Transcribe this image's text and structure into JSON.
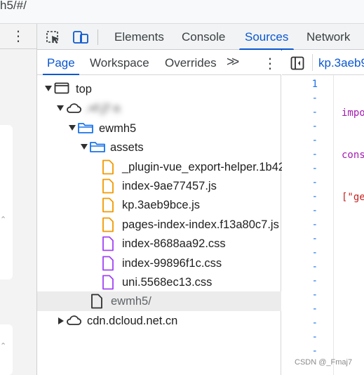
{
  "browser": {
    "url_fragment": "h5/#/"
  },
  "devtools": {
    "tabs": [
      {
        "label": "Elements",
        "active": false
      },
      {
        "label": "Console",
        "active": false
      },
      {
        "label": "Sources",
        "active": true
      },
      {
        "label": "Network",
        "active": false
      }
    ],
    "accent_color": "#0b57d0"
  },
  "navigator": {
    "tabs": [
      {
        "label": "Page",
        "active": true
      },
      {
        "label": "Workspace",
        "active": false
      },
      {
        "label": "Overrides",
        "active": false
      }
    ],
    "more_label": ">>",
    "tree": {
      "top": "top",
      "domain_redacted": "  .+f  j7  n",
      "folder_ewmh5": "ewmh5",
      "folder_assets": "assets",
      "files": [
        {
          "name": "_plugin-vue_export-helper.1b42",
          "type": "js"
        },
        {
          "name": "index-9ae77457.js",
          "type": "js"
        },
        {
          "name": "kp.3aeb9bce.js",
          "type": "js"
        },
        {
          "name": "pages-index-index.f13a80c7.js",
          "type": "js"
        },
        {
          "name": "index-8688aa92.css",
          "type": "css"
        },
        {
          "name": "index-99896f1c.css",
          "type": "css"
        },
        {
          "name": "uni.5568ec13.css",
          "type": "css"
        }
      ],
      "document": "ewmh5/",
      "cdn": "cdn.dcloud.net.cn"
    },
    "file_colors": {
      "js": "#f29900",
      "css": "#a142f4"
    }
  },
  "editor": {
    "open_file_tab": "kp.3aeb9",
    "line_numbers": [
      "1",
      "-",
      "-",
      "-",
      "-",
      "-",
      "-",
      "-",
      "-",
      "-",
      "-",
      "-",
      "-",
      "-",
      "-",
      "-",
      "-",
      "-",
      "-",
      "-"
    ],
    "code_lines": [
      "impo",
      "cons",
      "[\"ge"
    ]
  },
  "watermark": "CSDN @_Fmaj7"
}
